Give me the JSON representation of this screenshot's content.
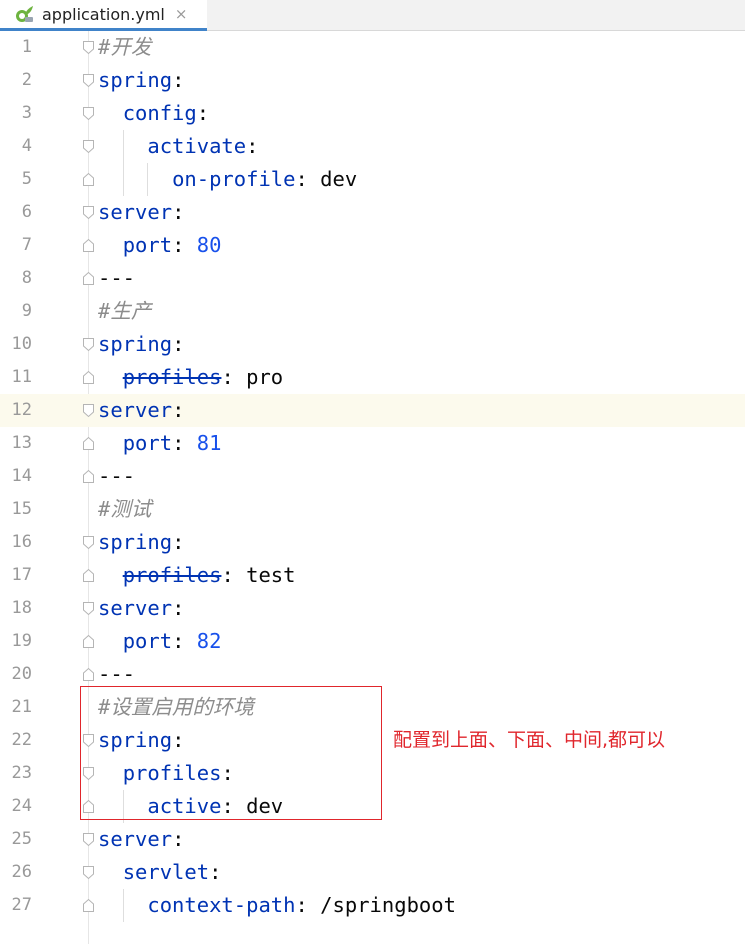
{
  "tab": {
    "filename": "application.yml",
    "close_glyph": "×",
    "icon": "spring-leaf-icon"
  },
  "colors": {
    "key": "#0033b3",
    "comment": "#8c8c8c",
    "number": "#1750eb",
    "annotation": "#e0262c",
    "current_line": "#fcfaed"
  },
  "lines": [
    {
      "n": "1",
      "parts": [
        {
          "t": "#开发",
          "c": "c"
        }
      ],
      "fold": "start",
      "indent": 0
    },
    {
      "n": "2",
      "parts": [
        {
          "t": "spring",
          "c": "k"
        },
        {
          "t": ":",
          "c": "s"
        }
      ],
      "fold": "start",
      "indent": 0
    },
    {
      "n": "3",
      "parts": [
        {
          "t": "  "
        },
        {
          "t": "config",
          "c": "k"
        },
        {
          "t": ":",
          "c": "s"
        }
      ],
      "fold": "start",
      "indent": 1
    },
    {
      "n": "4",
      "parts": [
        {
          "t": "    "
        },
        {
          "t": "activate",
          "c": "k"
        },
        {
          "t": ":",
          "c": "s"
        }
      ],
      "fold": "start",
      "indent": 2
    },
    {
      "n": "5",
      "parts": [
        {
          "t": "      "
        },
        {
          "t": "on-profile",
          "c": "k"
        },
        {
          "t": ": dev",
          "c": "s"
        }
      ],
      "fold": "end",
      "indent": 3
    },
    {
      "n": "6",
      "parts": [
        {
          "t": "server",
          "c": "k"
        },
        {
          "t": ":",
          "c": "s"
        }
      ],
      "fold": "start",
      "indent": 0
    },
    {
      "n": "7",
      "parts": [
        {
          "t": "  "
        },
        {
          "t": "port",
          "c": "k"
        },
        {
          "t": ": ",
          "c": "s"
        },
        {
          "t": "80",
          "c": "n"
        }
      ],
      "fold": "end",
      "indent": 1
    },
    {
      "n": "8",
      "parts": [
        {
          "t": "---",
          "c": "s"
        }
      ],
      "fold": "end",
      "indent": 0
    },
    {
      "n": "9",
      "parts": [
        {
          "t": "#生产",
          "c": "c"
        }
      ],
      "fold": "",
      "indent": 0
    },
    {
      "n": "10",
      "parts": [
        {
          "t": "spring",
          "c": "k"
        },
        {
          "t": ":",
          "c": "s"
        }
      ],
      "fold": "start",
      "indent": 0
    },
    {
      "n": "11",
      "parts": [
        {
          "t": "  "
        },
        {
          "t": "profiles",
          "c": "k strike"
        },
        {
          "t": ": pro",
          "c": "s"
        }
      ],
      "fold": "end",
      "indent": 1
    },
    {
      "n": "12",
      "parts": [
        {
          "t": "server",
          "c": "k"
        },
        {
          "t": ":",
          "c": "s"
        }
      ],
      "fold": "start",
      "indent": 0,
      "current": true
    },
    {
      "n": "13",
      "parts": [
        {
          "t": "  "
        },
        {
          "t": "port",
          "c": "k"
        },
        {
          "t": ": ",
          "c": "s"
        },
        {
          "t": "81",
          "c": "n"
        }
      ],
      "fold": "end",
      "indent": 1
    },
    {
      "n": "14",
      "parts": [
        {
          "t": "---",
          "c": "s"
        }
      ],
      "fold": "end",
      "indent": 0
    },
    {
      "n": "15",
      "parts": [
        {
          "t": "#测试",
          "c": "c"
        }
      ],
      "fold": "",
      "indent": 0
    },
    {
      "n": "16",
      "parts": [
        {
          "t": "spring",
          "c": "k"
        },
        {
          "t": ":",
          "c": "s"
        }
      ],
      "fold": "start",
      "indent": 0
    },
    {
      "n": "17",
      "parts": [
        {
          "t": "  "
        },
        {
          "t": "profiles",
          "c": "k strike"
        },
        {
          "t": ": test",
          "c": "s"
        }
      ],
      "fold": "end",
      "indent": 1
    },
    {
      "n": "18",
      "parts": [
        {
          "t": "server",
          "c": "k"
        },
        {
          "t": ":",
          "c": "s"
        }
      ],
      "fold": "start",
      "indent": 0
    },
    {
      "n": "19",
      "parts": [
        {
          "t": "  "
        },
        {
          "t": "port",
          "c": "k"
        },
        {
          "t": ": ",
          "c": "s"
        },
        {
          "t": "82",
          "c": "n"
        }
      ],
      "fold": "end",
      "indent": 1
    },
    {
      "n": "20",
      "parts": [
        {
          "t": "---",
          "c": "s"
        }
      ],
      "fold": "end",
      "indent": 0
    },
    {
      "n": "21",
      "parts": [
        {
          "t": "#设置启用的环境",
          "c": "c"
        }
      ],
      "fold": "",
      "indent": 0
    },
    {
      "n": "22",
      "parts": [
        {
          "t": "spring",
          "c": "k"
        },
        {
          "t": ":",
          "c": "s"
        }
      ],
      "fold": "start",
      "indent": 0
    },
    {
      "n": "23",
      "parts": [
        {
          "t": "  "
        },
        {
          "t": "profiles",
          "c": "k"
        },
        {
          "t": ":",
          "c": "s"
        }
      ],
      "fold": "start",
      "indent": 1
    },
    {
      "n": "24",
      "parts": [
        {
          "t": "    "
        },
        {
          "t": "active",
          "c": "k"
        },
        {
          "t": ": dev",
          "c": "s"
        }
      ],
      "fold": "end",
      "indent": 2
    },
    {
      "n": "25",
      "parts": [
        {
          "t": "server",
          "c": "k"
        },
        {
          "t": ":",
          "c": "s"
        }
      ],
      "fold": "start",
      "indent": 0
    },
    {
      "n": "26",
      "parts": [
        {
          "t": "  "
        },
        {
          "t": "servlet",
          "c": "k"
        },
        {
          "t": ":",
          "c": "s"
        }
      ],
      "fold": "start",
      "indent": 1
    },
    {
      "n": "27",
      "parts": [
        {
          "t": "    "
        },
        {
          "t": "context-path",
          "c": "k"
        },
        {
          "t": ": /springboot",
          "c": "s"
        }
      ],
      "fold": "end",
      "indent": 2
    }
  ],
  "annotation": {
    "text": "配置到上面、下面、中间,都可以"
  }
}
